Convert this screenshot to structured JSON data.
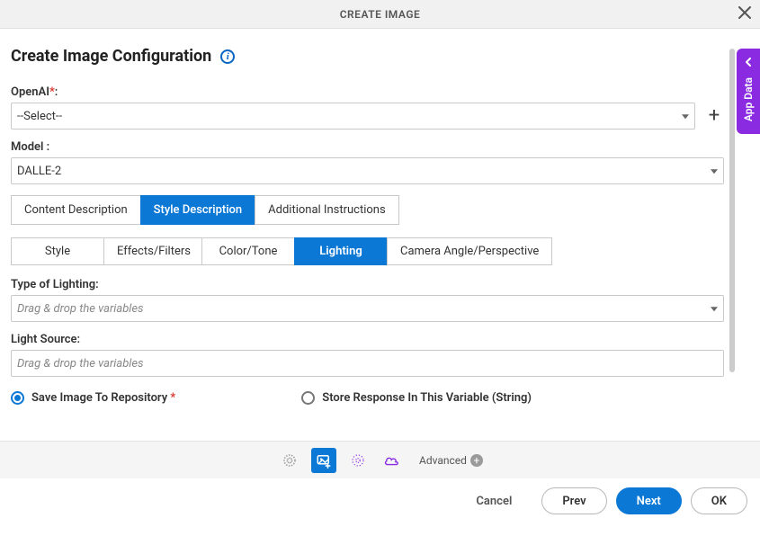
{
  "dialog": {
    "title": "CREATE IMAGE"
  },
  "sideTab": {
    "label": "App Data"
  },
  "heading": "Create Image Configuration",
  "fields": {
    "openai": {
      "label": "OpenAI",
      "required_star": "*",
      "colon": ":",
      "value": "--Select--"
    },
    "model": {
      "label": "Model :",
      "value": "DALLE-2"
    },
    "typeOfLighting": {
      "label": "Type of Lighting:",
      "placeholder": "Drag & drop the variables"
    },
    "lightSource": {
      "label": "Light Source:",
      "placeholder": "Drag & drop the variables"
    }
  },
  "mainTabs": [
    {
      "label": "Content Description"
    },
    {
      "label": "Style Description"
    },
    {
      "label": "Additional Instructions"
    }
  ],
  "subTabs": [
    {
      "label": "Style"
    },
    {
      "label": "Effects/Filters"
    },
    {
      "label": "Color/Tone"
    },
    {
      "label": "Lighting"
    },
    {
      "label": "Camera Angle/Perspective"
    }
  ],
  "radios": {
    "saveRepo": {
      "label": "Save Image To Repository",
      "star": "*"
    },
    "storeVar": {
      "label": "Store Response In This Variable (String)"
    }
  },
  "toolbar": {
    "advanced": "Advanced"
  },
  "footer": {
    "cancel": "Cancel",
    "prev": "Prev",
    "next": "Next",
    "ok": "OK"
  }
}
